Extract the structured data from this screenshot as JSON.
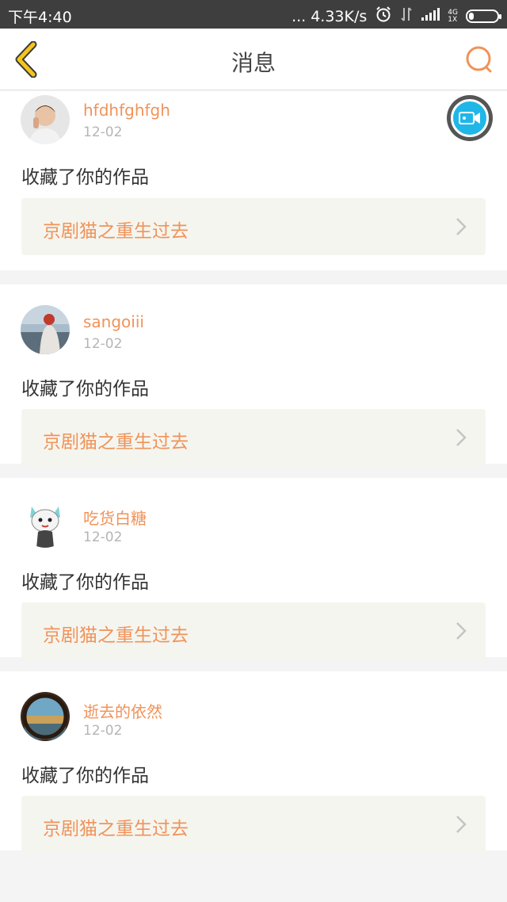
{
  "status_bar": {
    "time": "下午4:40",
    "speed": "... 4.33K/s",
    "net_top": "4G",
    "net_bottom": "1X"
  },
  "header": {
    "title": "消息"
  },
  "items": [
    {
      "username": "hfdhfghfgh",
      "date": "12-02",
      "action": "收藏了你的作品",
      "work_title": "京剧猫之重生过去"
    },
    {
      "username": "sangoiii",
      "date": "12-02",
      "action": "收藏了你的作品",
      "work_title": "京剧猫之重生过去"
    },
    {
      "username": "吃货白糖",
      "date": "12-02",
      "action": "收藏了你的作品",
      "work_title": "京剧猫之重生过去"
    },
    {
      "username": "逝去的依然",
      "date": "12-02",
      "action": "收藏了你的作品",
      "work_title": "京剧猫之重生过去"
    }
  ],
  "colors": {
    "accent": "#f0935a",
    "back_arrow": "#f5c518",
    "video_button": "#1fb7e8"
  },
  "icons": {
    "back": "chevron-left-icon",
    "search": "search-icon",
    "video": "video-camera-icon",
    "chevron": "chevron-right-icon"
  }
}
